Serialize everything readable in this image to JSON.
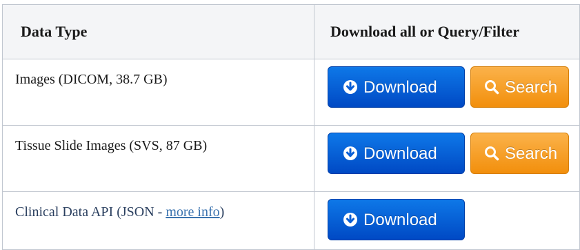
{
  "table": {
    "headers": [
      "Data Type",
      "Download all or Query/Filter"
    ],
    "rows": [
      {
        "label": "Images (DICOM, 38.7 GB)",
        "download_label": "Download",
        "search_label": "Search"
      },
      {
        "label": "Tissue Slide Images (SVS, 87 GB)",
        "download_label": "Download",
        "search_label": "Search"
      },
      {
        "label_prefix": "Clinical Data API (JSON - ",
        "link_text": "more info",
        "label_suffix": ")",
        "download_label": "Download"
      }
    ]
  },
  "icons": {
    "download": "arrow-down-circle-icon",
    "search": "magnifier-icon"
  },
  "colors": {
    "download_button": "#0a5fd6",
    "search_button": "#f5a31f",
    "link": "#3b73af",
    "header_background": "#f4f5f7",
    "border": "#c1c7d0"
  }
}
